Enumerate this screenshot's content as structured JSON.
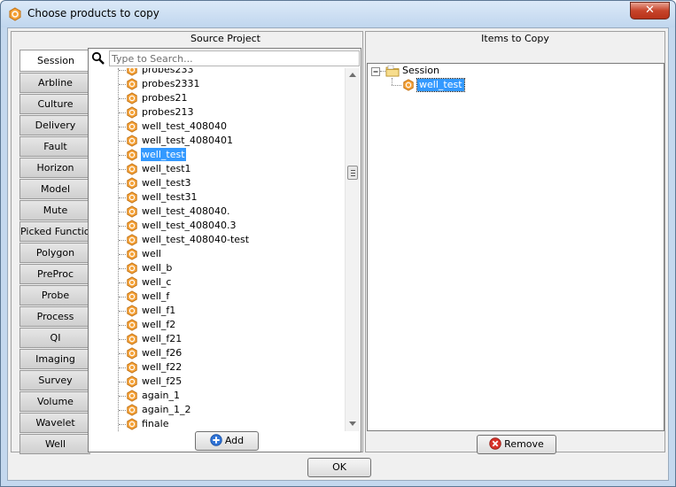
{
  "window": {
    "title": "Choose products to copy",
    "close_label": "✕"
  },
  "source": {
    "title": "Source Project",
    "tabs": [
      "Session",
      "Arbline",
      "Culture",
      "Delivery",
      "Fault",
      "Horizon",
      "Model",
      "Mute",
      "Picked Function",
      "Polygon",
      "PreProc",
      "Probe",
      "Process",
      "QI",
      "Imaging",
      "Survey",
      "Volume",
      "Wavelet",
      "Well"
    ],
    "active_tab": "Session",
    "search": {
      "placeholder": "Type to Search...",
      "value": ""
    },
    "items": [
      "probes233",
      "probes2331",
      "probes21",
      "probes213",
      "well_test_408040",
      "well_test_4080401",
      "well_test",
      "well_test1",
      "well_test3",
      "well_test31",
      "well_test_408040.",
      "well_test_408040.3",
      "well_test_408040-test",
      "well",
      "well_b",
      "well_c",
      "well_f",
      "well_f1",
      "well_f2",
      "well_f21",
      "well_f26",
      "well_f22",
      "well_f25",
      "again_1",
      "again_1_2",
      "finale"
    ],
    "selected_item": "well_test",
    "add_label": "Add"
  },
  "copy": {
    "title": "Items to Copy",
    "root_label": "Session",
    "child_label": "well_test",
    "remove_label": "Remove"
  },
  "ok_label": "OK",
  "colors": {
    "product_icon": "#f0a030",
    "selection": "#3399ff",
    "close": "#c7442b"
  }
}
